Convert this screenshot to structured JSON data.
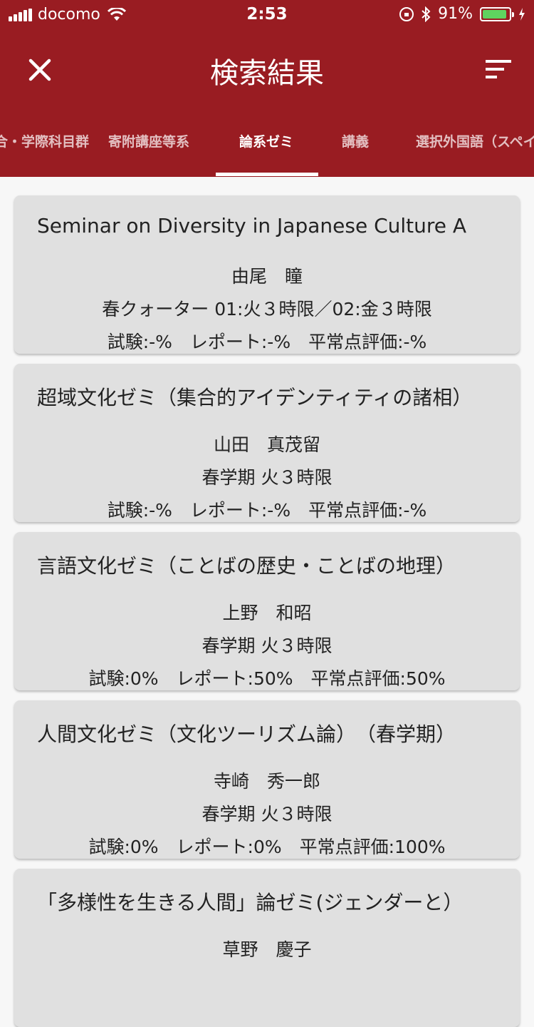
{
  "status_bar": {
    "carrier": "docomo",
    "time": "2:53",
    "battery": "91%",
    "battery_level": 0.91
  },
  "header": {
    "title": "検索結果"
  },
  "tabs": [
    {
      "label": "合・学際科目群"
    },
    {
      "label": "寄附講座等系"
    },
    {
      "label": "論系ゼミ",
      "active": true
    },
    {
      "label": "講義"
    },
    {
      "label": "選択外国語（スペイ"
    }
  ],
  "results": [
    {
      "title": "Seminar on Diversity in Japanese Culture A",
      "instructor": "由尾　瞳",
      "schedule": "春クォーター  01:火３時限／02:金３時限",
      "grading": "試験:-%　レポート:-%　平常点評価:-%"
    },
    {
      "title": "超域文化ゼミ（集合的アイデンティティの諸相）",
      "instructor": "山田　真茂留",
      "schedule": "春学期  火３時限",
      "grading": "試験:-%　レポート:-%　平常点評価:-%"
    },
    {
      "title": "言語文化ゼミ（ことばの歴史・ことばの地理）",
      "instructor": "上野　和昭",
      "schedule": "春学期  火３時限",
      "grading": "試験:0%　レポート:50%　平常点評価:50%"
    },
    {
      "title": "人間文化ゼミ（文化ツーリズム論）　（春学期）",
      "instructor": "寺崎　秀一郎",
      "schedule": "春学期  火３時限",
      "grading": "試験:0%　レポート:0%　平常点評価:100%"
    },
    {
      "title": "「多様性を生きる人間」論ゼミ(ジェンダーと）",
      "instructor": "草野　慶子",
      "schedule": "",
      "grading": ""
    }
  ],
  "colors": {
    "header": "#991c22",
    "card": "#e0e0e0",
    "background": "#f7f7f7"
  }
}
